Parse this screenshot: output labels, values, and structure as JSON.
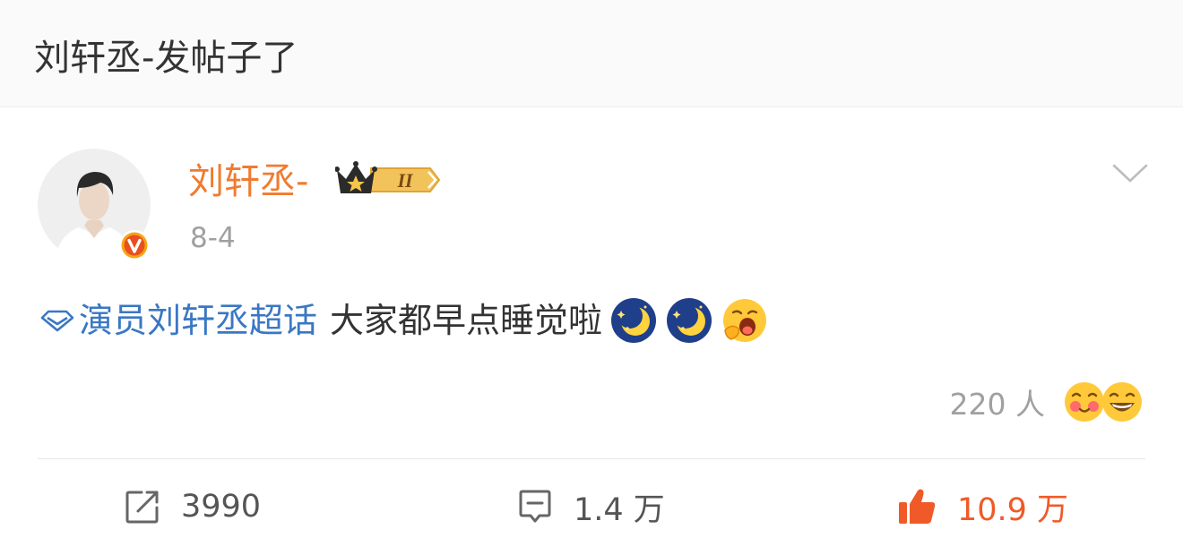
{
  "header": {
    "title": "刘轩丞-发帖子了"
  },
  "post": {
    "author": "刘轩丞-",
    "member_level": "II",
    "date": "8-4",
    "topic": "演员刘轩丞超话",
    "text": "大家都早点睡觉啦",
    "emojis": [
      "moon-sleep-emoji",
      "moon-sleep-emoji",
      "yawn-emoji"
    ],
    "reactions": {
      "count_label": "220 人",
      "faces": [
        "blush-emoji",
        "grin-emoji"
      ]
    }
  },
  "actions": {
    "repost": "3990",
    "comment": "1.4 万",
    "like": "10.9 万"
  },
  "colors": {
    "username": "#f07b30",
    "topic": "#3a77c4",
    "like": "#f05a28",
    "secondary_text": "#a0a0a0"
  }
}
